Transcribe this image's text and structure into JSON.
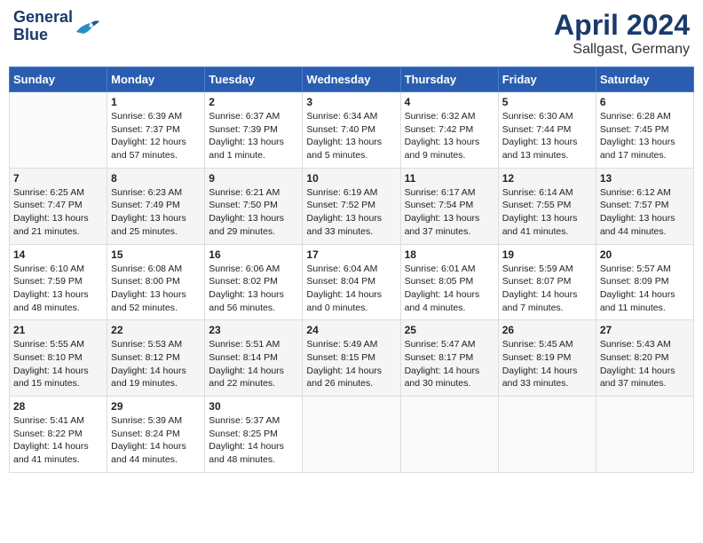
{
  "header": {
    "logo_line1": "General",
    "logo_line2": "Blue",
    "month": "April 2024",
    "location": "Sallgast, Germany"
  },
  "weekdays": [
    "Sunday",
    "Monday",
    "Tuesday",
    "Wednesday",
    "Thursday",
    "Friday",
    "Saturday"
  ],
  "weeks": [
    [
      {
        "day": "",
        "sunrise": "",
        "sunset": "",
        "daylight": ""
      },
      {
        "day": "1",
        "sunrise": "Sunrise: 6:39 AM",
        "sunset": "Sunset: 7:37 PM",
        "daylight": "Daylight: 12 hours and 57 minutes."
      },
      {
        "day": "2",
        "sunrise": "Sunrise: 6:37 AM",
        "sunset": "Sunset: 7:39 PM",
        "daylight": "Daylight: 13 hours and 1 minute."
      },
      {
        "day": "3",
        "sunrise": "Sunrise: 6:34 AM",
        "sunset": "Sunset: 7:40 PM",
        "daylight": "Daylight: 13 hours and 5 minutes."
      },
      {
        "day": "4",
        "sunrise": "Sunrise: 6:32 AM",
        "sunset": "Sunset: 7:42 PM",
        "daylight": "Daylight: 13 hours and 9 minutes."
      },
      {
        "day": "5",
        "sunrise": "Sunrise: 6:30 AM",
        "sunset": "Sunset: 7:44 PM",
        "daylight": "Daylight: 13 hours and 13 minutes."
      },
      {
        "day": "6",
        "sunrise": "Sunrise: 6:28 AM",
        "sunset": "Sunset: 7:45 PM",
        "daylight": "Daylight: 13 hours and 17 minutes."
      }
    ],
    [
      {
        "day": "7",
        "sunrise": "Sunrise: 6:25 AM",
        "sunset": "Sunset: 7:47 PM",
        "daylight": "Daylight: 13 hours and 21 minutes."
      },
      {
        "day": "8",
        "sunrise": "Sunrise: 6:23 AM",
        "sunset": "Sunset: 7:49 PM",
        "daylight": "Daylight: 13 hours and 25 minutes."
      },
      {
        "day": "9",
        "sunrise": "Sunrise: 6:21 AM",
        "sunset": "Sunset: 7:50 PM",
        "daylight": "Daylight: 13 hours and 29 minutes."
      },
      {
        "day": "10",
        "sunrise": "Sunrise: 6:19 AM",
        "sunset": "Sunset: 7:52 PM",
        "daylight": "Daylight: 13 hours and 33 minutes."
      },
      {
        "day": "11",
        "sunrise": "Sunrise: 6:17 AM",
        "sunset": "Sunset: 7:54 PM",
        "daylight": "Daylight: 13 hours and 37 minutes."
      },
      {
        "day": "12",
        "sunrise": "Sunrise: 6:14 AM",
        "sunset": "Sunset: 7:55 PM",
        "daylight": "Daylight: 13 hours and 41 minutes."
      },
      {
        "day": "13",
        "sunrise": "Sunrise: 6:12 AM",
        "sunset": "Sunset: 7:57 PM",
        "daylight": "Daylight: 13 hours and 44 minutes."
      }
    ],
    [
      {
        "day": "14",
        "sunrise": "Sunrise: 6:10 AM",
        "sunset": "Sunset: 7:59 PM",
        "daylight": "Daylight: 13 hours and 48 minutes."
      },
      {
        "day": "15",
        "sunrise": "Sunrise: 6:08 AM",
        "sunset": "Sunset: 8:00 PM",
        "daylight": "Daylight: 13 hours and 52 minutes."
      },
      {
        "day": "16",
        "sunrise": "Sunrise: 6:06 AM",
        "sunset": "Sunset: 8:02 PM",
        "daylight": "Daylight: 13 hours and 56 minutes."
      },
      {
        "day": "17",
        "sunrise": "Sunrise: 6:04 AM",
        "sunset": "Sunset: 8:04 PM",
        "daylight": "Daylight: 14 hours and 0 minutes."
      },
      {
        "day": "18",
        "sunrise": "Sunrise: 6:01 AM",
        "sunset": "Sunset: 8:05 PM",
        "daylight": "Daylight: 14 hours and 4 minutes."
      },
      {
        "day": "19",
        "sunrise": "Sunrise: 5:59 AM",
        "sunset": "Sunset: 8:07 PM",
        "daylight": "Daylight: 14 hours and 7 minutes."
      },
      {
        "day": "20",
        "sunrise": "Sunrise: 5:57 AM",
        "sunset": "Sunset: 8:09 PM",
        "daylight": "Daylight: 14 hours and 11 minutes."
      }
    ],
    [
      {
        "day": "21",
        "sunrise": "Sunrise: 5:55 AM",
        "sunset": "Sunset: 8:10 PM",
        "daylight": "Daylight: 14 hours and 15 minutes."
      },
      {
        "day": "22",
        "sunrise": "Sunrise: 5:53 AM",
        "sunset": "Sunset: 8:12 PM",
        "daylight": "Daylight: 14 hours and 19 minutes."
      },
      {
        "day": "23",
        "sunrise": "Sunrise: 5:51 AM",
        "sunset": "Sunset: 8:14 PM",
        "daylight": "Daylight: 14 hours and 22 minutes."
      },
      {
        "day": "24",
        "sunrise": "Sunrise: 5:49 AM",
        "sunset": "Sunset: 8:15 PM",
        "daylight": "Daylight: 14 hours and 26 minutes."
      },
      {
        "day": "25",
        "sunrise": "Sunrise: 5:47 AM",
        "sunset": "Sunset: 8:17 PM",
        "daylight": "Daylight: 14 hours and 30 minutes."
      },
      {
        "day": "26",
        "sunrise": "Sunrise: 5:45 AM",
        "sunset": "Sunset: 8:19 PM",
        "daylight": "Daylight: 14 hours and 33 minutes."
      },
      {
        "day": "27",
        "sunrise": "Sunrise: 5:43 AM",
        "sunset": "Sunset: 8:20 PM",
        "daylight": "Daylight: 14 hours and 37 minutes."
      }
    ],
    [
      {
        "day": "28",
        "sunrise": "Sunrise: 5:41 AM",
        "sunset": "Sunset: 8:22 PM",
        "daylight": "Daylight: 14 hours and 41 minutes."
      },
      {
        "day": "29",
        "sunrise": "Sunrise: 5:39 AM",
        "sunset": "Sunset: 8:24 PM",
        "daylight": "Daylight: 14 hours and 44 minutes."
      },
      {
        "day": "30",
        "sunrise": "Sunrise: 5:37 AM",
        "sunset": "Sunset: 8:25 PM",
        "daylight": "Daylight: 14 hours and 48 minutes."
      },
      {
        "day": "",
        "sunrise": "",
        "sunset": "",
        "daylight": ""
      },
      {
        "day": "",
        "sunrise": "",
        "sunset": "",
        "daylight": ""
      },
      {
        "day": "",
        "sunrise": "",
        "sunset": "",
        "daylight": ""
      },
      {
        "day": "",
        "sunrise": "",
        "sunset": "",
        "daylight": ""
      }
    ]
  ]
}
